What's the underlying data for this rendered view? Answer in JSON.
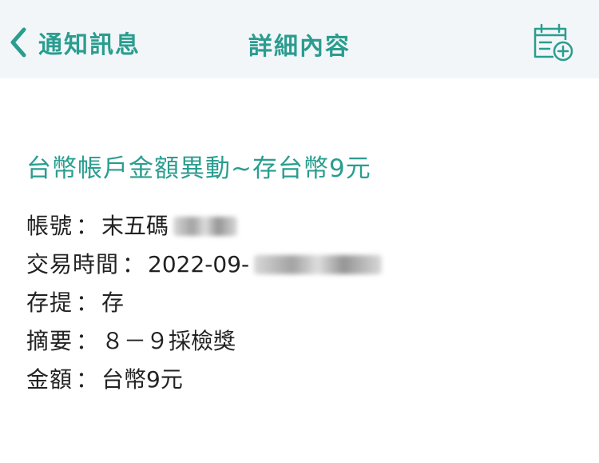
{
  "navbar": {
    "back_label": "通知訊息",
    "title": "詳細內容",
    "back_icon": "chevron-left-icon",
    "action_icon": "calendar-add-icon"
  },
  "message": {
    "title": "台幣帳戶金額異動~存台幣9元",
    "rows": [
      {
        "label": "帳號",
        "sep": "：",
        "value": "末五碼"
      },
      {
        "label": "交易時間",
        "sep": "：",
        "value": "2022-09-"
      },
      {
        "label": "存提",
        "sep": "：",
        "value": "存"
      },
      {
        "label": "摘要",
        "sep": "：",
        "value": "８－９採檢獎"
      },
      {
        "label": "金額",
        "sep": "：",
        "value": "台幣9元"
      }
    ]
  },
  "colors": {
    "accent": "#2a9d8f",
    "navbar_bg": "#f3f6f9",
    "text": "#222222"
  }
}
